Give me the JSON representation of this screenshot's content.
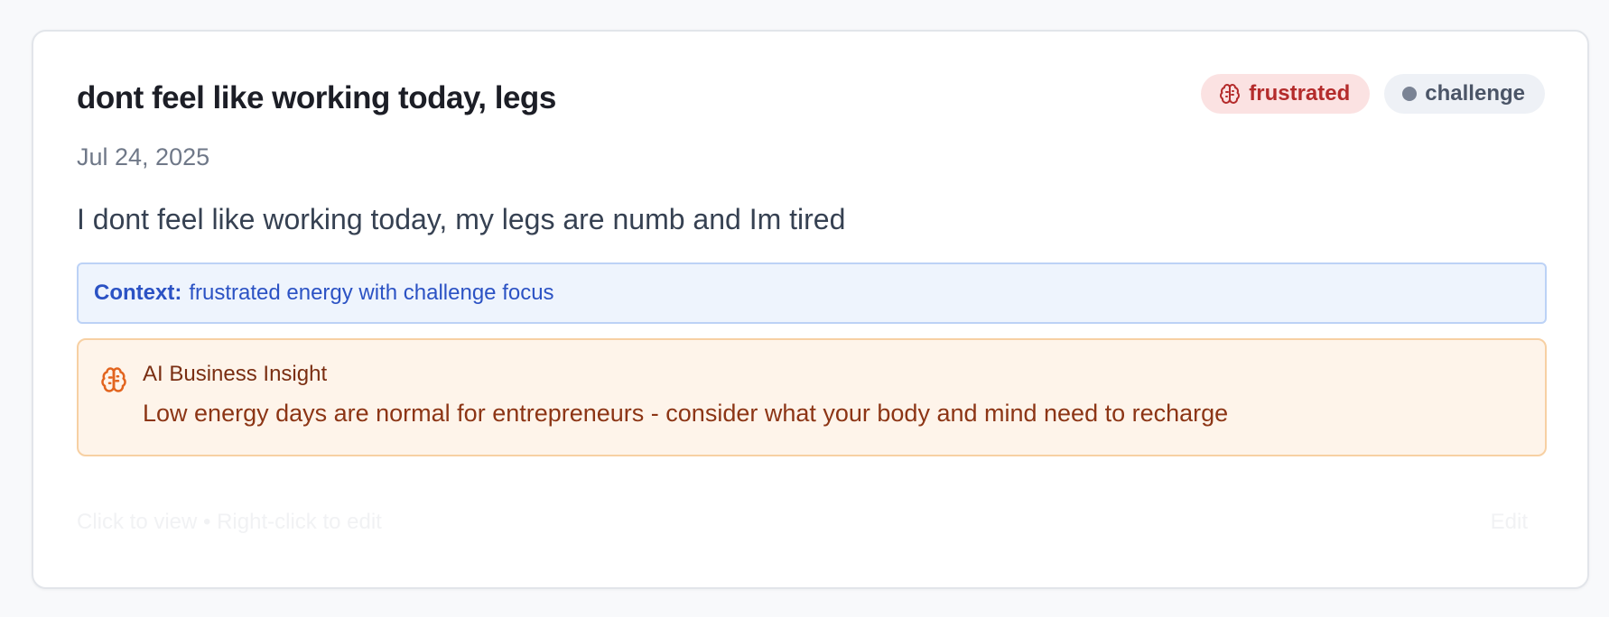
{
  "entry": {
    "title": "dont feel like working today, legs",
    "date": "Jul 24, 2025",
    "body": "I dont feel like working today, my legs are numb and Im tired"
  },
  "tags": {
    "mood": {
      "label": "frustrated",
      "icon": "brain-icon",
      "color": "#b42b2b"
    },
    "category": {
      "label": "challenge",
      "icon": "dot-icon",
      "color": "#4b5567"
    }
  },
  "context": {
    "label": "Context:",
    "text": "frustrated energy with challenge focus"
  },
  "insight": {
    "icon": "brain-icon",
    "title": "AI Business Insight",
    "text": "Low energy days are normal for entrepreneurs - consider what your body and mind need to recharge"
  },
  "footer": {
    "hint": "Click to view • Right-click to edit",
    "action": "Edit"
  }
}
